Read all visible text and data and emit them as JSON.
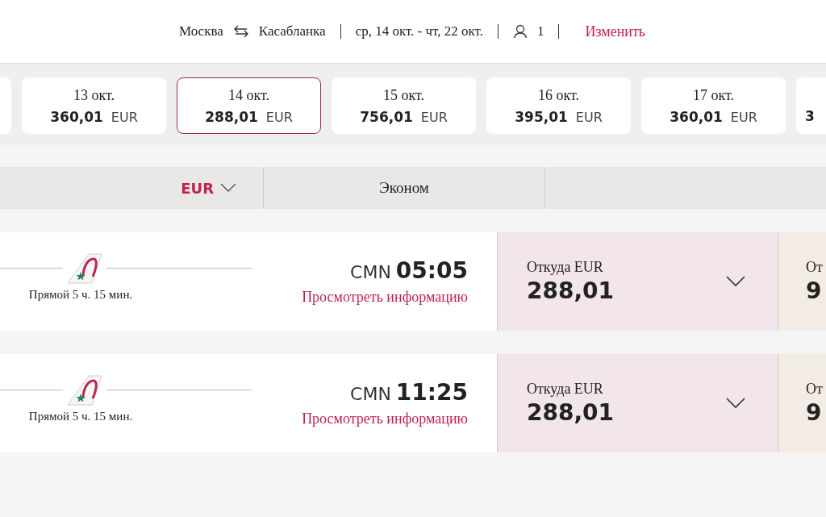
{
  "header": {
    "origin": "Москва",
    "destination": "Касабланка",
    "dates": "ср, 14 окт. - чт, 22 окт.",
    "passengers": "1",
    "change_link": "Изменить"
  },
  "date_cards": [
    {
      "date": "13 окт.",
      "price": "360,01",
      "currency": "EUR",
      "selected": false
    },
    {
      "date": "14 окт.",
      "price": "288,01",
      "currency": "EUR",
      "selected": true
    },
    {
      "date": "15 окт.",
      "price": "756,01",
      "currency": "EUR",
      "selected": false
    },
    {
      "date": "16 окт.",
      "price": "395,01",
      "currency": "EUR",
      "selected": false
    },
    {
      "date": "17 окт.",
      "price": "360,01",
      "currency": "EUR",
      "selected": false
    },
    {
      "price": "3",
      "selected": false
    }
  ],
  "table_header": {
    "currency": "EUR",
    "columns": [
      "Эконом",
      ""
    ]
  },
  "flights": [
    {
      "stops": "Прямой 5 ч. 15 мин.",
      "airport": "CMN",
      "time": "05:05",
      "details_link": "Просмотреть информацию",
      "economy": {
        "label": "Откуда EUR",
        "price": "288,01"
      },
      "business": {
        "label": "От",
        "price": "9"
      }
    },
    {
      "stops": "Прямой 5 ч. 15 мин.",
      "airport": "CMN",
      "time": "11:25",
      "details_link": "Просмотреть информацию",
      "economy": {
        "label": "Откуда EUR",
        "price": "288,01"
      },
      "business": {
        "label": "От",
        "price": "9"
      }
    }
  ]
}
